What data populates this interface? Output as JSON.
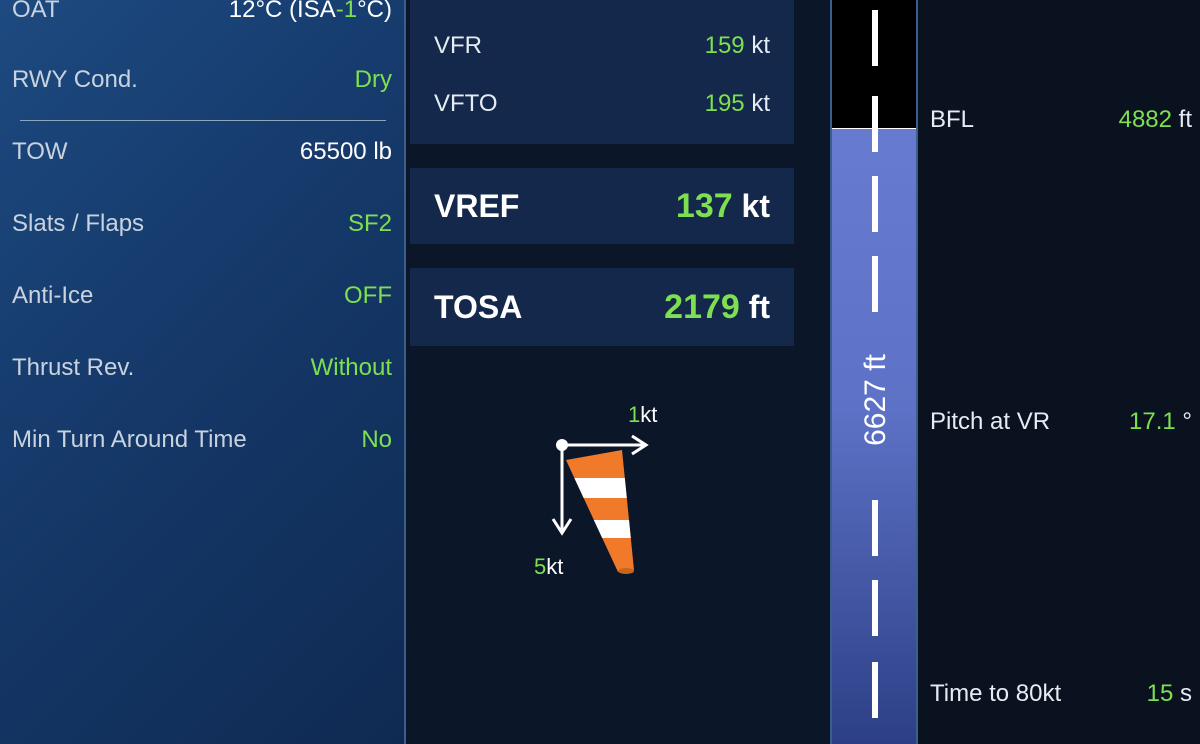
{
  "left": {
    "oat": {
      "label": "OAT",
      "value_prefix": "12°C (ISA",
      "value_delta": "-1",
      "value_suffix": "°C)"
    },
    "rwy_cond": {
      "label": "RWY Cond.",
      "value": "Dry"
    },
    "tow": {
      "label": "TOW",
      "value": "65500 lb"
    },
    "slats_flaps": {
      "label": "Slats / Flaps",
      "value": "SF2"
    },
    "anti_ice": {
      "label": "Anti-Ice",
      "value": "OFF"
    },
    "thrust_rev": {
      "label": "Thrust Rev.",
      "value": "Without"
    },
    "min_turn": {
      "label": "Min Turn Around Time",
      "value": "No"
    }
  },
  "speeds": {
    "vfr": {
      "label": "VFR",
      "value": "159",
      "unit": "kt"
    },
    "vfto": {
      "label": "VFTO",
      "value": "195",
      "unit": "kt"
    },
    "vref": {
      "label": "VREF",
      "value": "137",
      "unit": "kt"
    },
    "tosa": {
      "label": "TOSA",
      "value": "2179",
      "unit": "ft"
    }
  },
  "wind": {
    "headwind_value": "1",
    "headwind_unit": "kt",
    "crosswind_value": "5",
    "crosswind_unit": "kt",
    "sock_icon": "windsock-icon"
  },
  "runway": {
    "length_label": "6627 ft"
  },
  "right": {
    "bfl": {
      "label": "BFL",
      "value": "4882",
      "unit": "ft"
    },
    "pitch": {
      "label": "Pitch at VR",
      "value": "17.1",
      "unit": "°"
    },
    "time80": {
      "label": "Time to 80kt",
      "value": "15",
      "unit": "s"
    }
  },
  "colors": {
    "accent_green": "#7ee050",
    "panel_blue": "#1d4a80",
    "runway_blue": "#6b7fd4"
  }
}
